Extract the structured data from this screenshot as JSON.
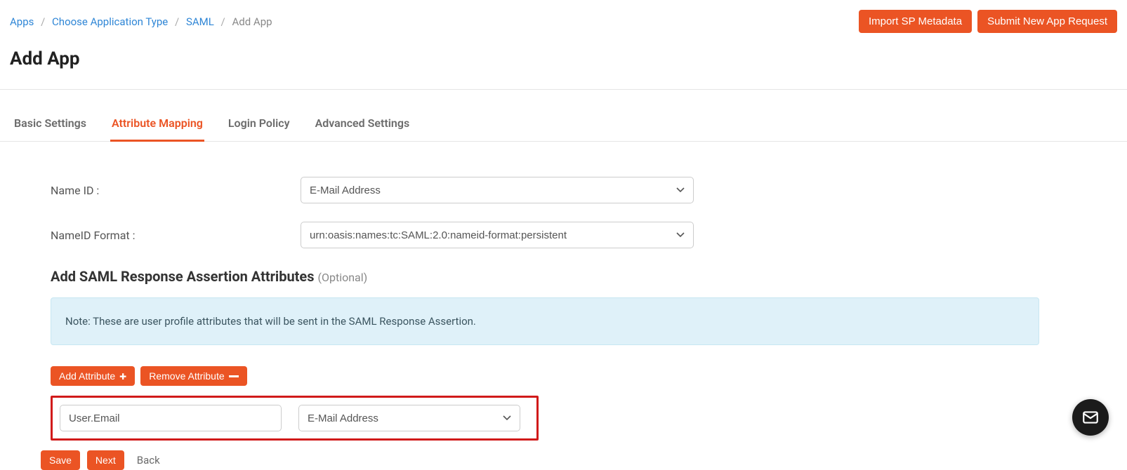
{
  "breadcrumb": {
    "items": [
      {
        "label": "Apps",
        "link": true
      },
      {
        "label": "Choose Application Type",
        "link": true
      },
      {
        "label": "SAML",
        "link": true
      },
      {
        "label": "Add App",
        "link": false
      }
    ]
  },
  "top_actions": {
    "import_label": "Import SP Metadata",
    "submit_label": "Submit New App Request"
  },
  "page_title": "Add App",
  "tabs": [
    {
      "id": "basic",
      "label": "Basic Settings",
      "active": false
    },
    {
      "id": "attr",
      "label": "Attribute Mapping",
      "active": true
    },
    {
      "id": "login",
      "label": "Login Policy",
      "active": false
    },
    {
      "id": "adv",
      "label": "Advanced Settings",
      "active": false
    }
  ],
  "form": {
    "name_id_label": "Name ID :",
    "name_id_value": "E-Mail Address",
    "nameid_format_label": "NameID Format :",
    "nameid_format_value": "urn:oasis:names:tc:SAML:2.0:nameid-format:persistent"
  },
  "assertion": {
    "heading": "Add SAML Response Assertion Attributes",
    "optional": "(Optional)",
    "note": "Note: These are user profile attributes that will be sent in the SAML Response Assertion.",
    "add_btn": "Add Attribute",
    "remove_btn": "Remove Attribute",
    "row": {
      "name_value": "User.Email",
      "mapping_value": "E-Mail Address"
    }
  },
  "footer": {
    "save": "Save",
    "next": "Next",
    "back": "Back"
  }
}
